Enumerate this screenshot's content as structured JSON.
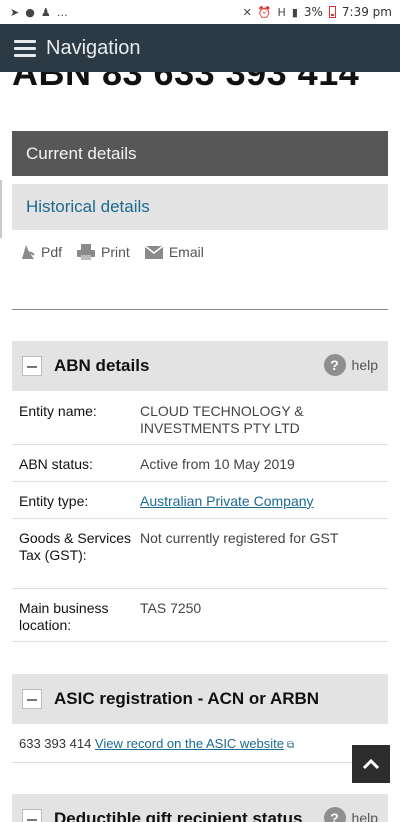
{
  "status_bar": {
    "signal_text": "H",
    "battery": "3%",
    "time": "7:39 pm"
  },
  "nav": {
    "title": "Navigation"
  },
  "page": {
    "abn_heading": "ABN 83 633 393 414"
  },
  "tabs": {
    "current": "Current details",
    "historical": "Historical details"
  },
  "actions": {
    "pdf": "Pdf",
    "print": "Print",
    "email": "Email"
  },
  "abn_section": {
    "title": "ABN details",
    "help": "help",
    "rows": [
      {
        "label": "Entity name:",
        "value": "CLOUD TECHNOLOGY & INVESTMENTS PTY LTD"
      },
      {
        "label": "ABN status:",
        "value": "Active from 10 May 2019"
      },
      {
        "label": "Entity type:",
        "value": "Australian Private Company"
      },
      {
        "label": "Goods & Services Tax (GST):",
        "value": "Not currently registered for GST"
      },
      {
        "label": "Main business location:",
        "value": "TAS 7250"
      }
    ]
  },
  "asic_section": {
    "title": "ASIC registration - ACN or ARBN",
    "acn": "633 393 414",
    "link": "View record on the ASIC website"
  },
  "dgr_section": {
    "title": "Deductible gift recipient status",
    "help": "help"
  }
}
